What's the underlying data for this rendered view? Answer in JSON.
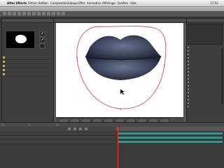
{
  "menubar": {
    "apple": "",
    "app": "After Effects",
    "items": [
      "Fichier",
      "Edition",
      "Composition",
      "Calque",
      "Effet",
      "Animation",
      "Affichage",
      "Fenêtre",
      "Aide"
    ],
    "clock": "17:53"
  },
  "window": {
    "title": ""
  },
  "project_panel": {
    "tab": "",
    "rows": [
      "",
      "",
      "",
      "",
      ""
    ]
  },
  "comp_viewer": {
    "accent_mask_color": "#d94b57",
    "zoom": "",
    "timecode": ""
  },
  "effects_panel": {
    "tab": "",
    "rows": [
      "",
      "",
      "",
      "",
      "",
      "",
      "",
      "",
      "",
      "",
      "",
      "",
      "",
      "",
      "",
      "",
      "",
      ""
    ]
  },
  "timeline": {
    "tabs": [
      "",
      "",
      ""
    ],
    "timecode": "",
    "layers": [
      "",
      "",
      ""
    ]
  },
  "colors": {
    "layer_bar": "#3e8f8a",
    "playhead": "#ff3030",
    "mask": "#d94b57"
  }
}
